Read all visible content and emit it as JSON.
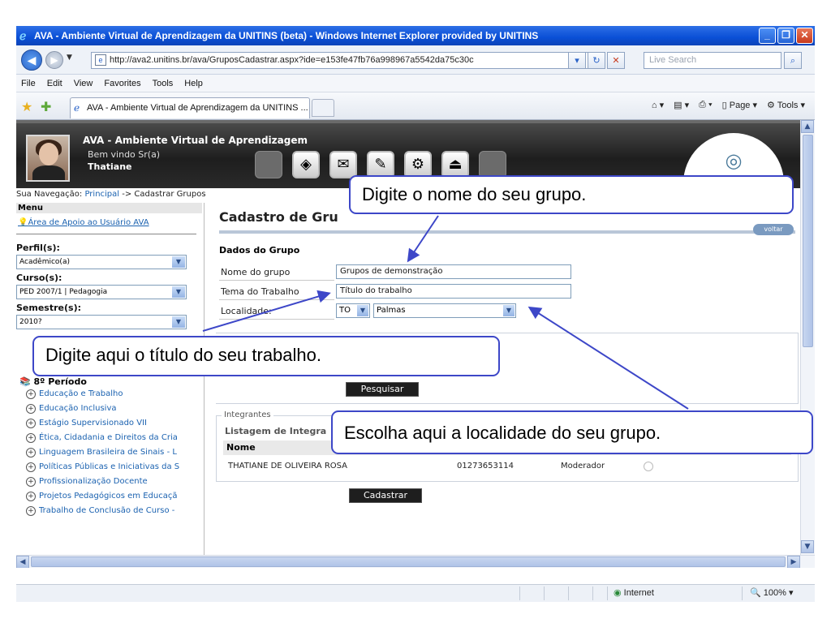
{
  "browser": {
    "title": "AVA - Ambiente Virtual de Aprendizagem da UNITINS (beta) - Windows Internet Explorer provided by UNITINS",
    "url": "http://ava2.unitins.br/ava/GruposCadastrar.aspx?ide=e153fe47fb76a998967a5542da75c30c",
    "search_placeholder": "Live Search",
    "menu": [
      "File",
      "Edit",
      "View",
      "Favorites",
      "Tools",
      "Help"
    ],
    "tab_label": "AVA - Ambiente Virtual de Aprendizagem da UNITINS ...",
    "cmd_page": "Page",
    "cmd_tools": "Tools",
    "status_zone": "Internet",
    "zoom": "100%"
  },
  "header": {
    "site_title": "AVA - Ambiente Virtual de Aprendizagem",
    "welcome": "Bem vindo Sr(a)",
    "user_name": "Thatiane"
  },
  "breadcrumb": {
    "prefix": "Sua Navegação:",
    "home": "Principal",
    "rest": "-> Cadastrar Grupos"
  },
  "sidebar": {
    "menu_title": "Menu",
    "help_link": "Área de Apoio ao Usuário AVA",
    "perfil_label": "Perfil(s):",
    "perfil_value": "Acadêmico(a)",
    "curso_label": "Curso(s):",
    "curso_value": "PED 2007/1 | Pedagogia",
    "semestre_label": "Semestre(s):",
    "semestre_value": "2010?",
    "periodo_title": "8º Período",
    "courses": [
      "Educação e Trabalho",
      "Educação Inclusiva",
      "Estágio Supervisionado VII",
      "Ética, Cidadania e Direitos da Cria",
      "Linguagem Brasileira de Sinais - L",
      "Políticas Públicas e Iniciativas da S",
      "Profissionalização Docente",
      "Projetos Pedagógicos em Educaçã",
      "Trabalho de Conclusão de Curso -"
    ]
  },
  "main": {
    "page_title": "Cadastro de Gru",
    "voltar": "voltar",
    "section_title": "Dados do Grupo",
    "nome_label": "Nome do grupo",
    "nome_value": "Grupos de demonstração",
    "tema_label": "Tema do Trabalho",
    "tema_value": "Título do trabalho",
    "localidade_label": "Localidade:",
    "uf_value": "TO",
    "cidade_value": "Palmas",
    "pesquisar": "Pesquisar",
    "integrantes_legend": "Integrantes",
    "listagem_title": "Listagem de Integra",
    "col_nome": "Nome",
    "member": {
      "name": "THATIANE DE OLIVEIRA ROSA",
      "code": "01273653114",
      "role": "Moderador"
    },
    "cadastrar": "Cadastrar"
  },
  "callouts": {
    "nome": "Digite o nome do seu grupo.",
    "titulo": "Digite aqui o título do seu trabalho.",
    "localidade": "Escolha aqui a localidade do seu grupo."
  },
  "colors": {
    "callout_border": "#3d47c8",
    "link": "#1b62b0",
    "header_bg": "#1e1e1e",
    "titlebar": "#0a4fd6"
  },
  "icons": {
    "nome_pointer": "arrow",
    "titulo_pointer": "arrow",
    "localidade_pointer": "arrow"
  }
}
